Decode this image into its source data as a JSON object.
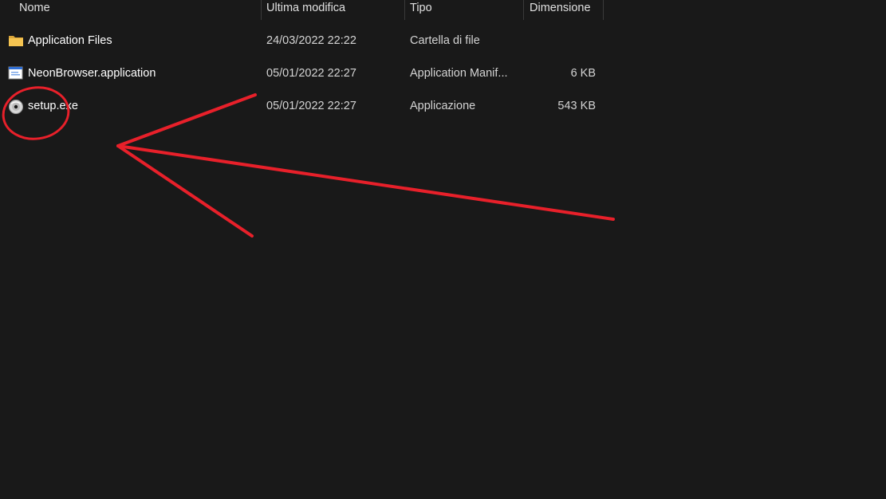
{
  "columns": {
    "name": "Nome",
    "date": "Ultima modifica",
    "type": "Tipo",
    "size": "Dimensione"
  },
  "files": [
    {
      "icon": "folder-icon",
      "name": "Application Files",
      "date": "24/03/2022 22:22",
      "type": "Cartella di file",
      "size": ""
    },
    {
      "icon": "application-manifest-icon",
      "name": "NeonBrowser.application",
      "date": "05/01/2022 22:27",
      "type": "Application Manif...",
      "size": "6 KB"
    },
    {
      "icon": "setup-disc-icon",
      "name": "setup.exe",
      "date": "05/01/2022 22:27",
      "type": "Applicazione",
      "size": "543 KB"
    }
  ],
  "colors": {
    "background": "#191919",
    "annotation": "#e8202a",
    "folder": "#f5c451"
  }
}
